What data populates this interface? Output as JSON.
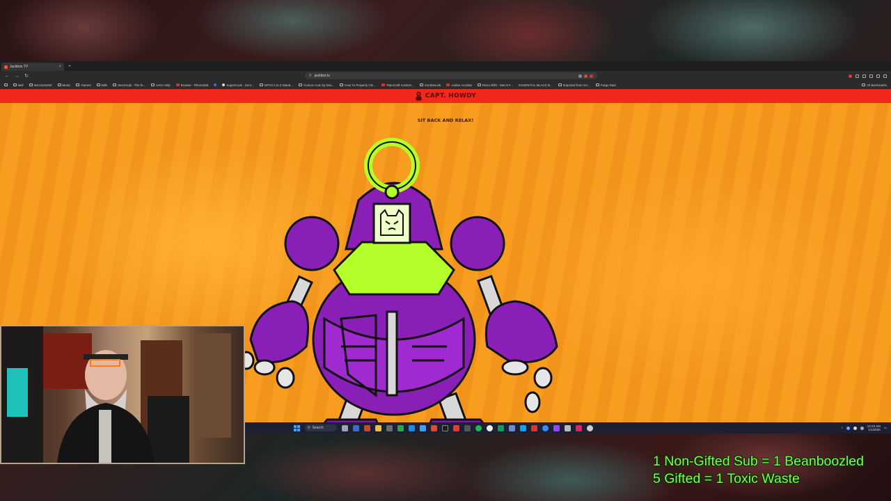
{
  "browser": {
    "tab_title": "Jackbox.TV",
    "url": "jackbox.tv",
    "bookmarks": [
      "Bell",
      "ServiceNOW",
      "Music",
      "Games",
      "Bills",
      "Stecinrojk - The fe...",
      "Uni's Help",
      "Browse - RhomoDB",
      "",
      "SuperCook - Zero...",
      "MTV2 A to Z Marat...",
      "Custom cuts by Des...",
      "How To Properly Cle...",
      "TitanCraft Custom...",
      "ZombieLink",
      "Adobe Acrobat",
      "Retro Rifle - Men's F...",
      "ESSENTIAL BLACK B...",
      "Imported from Go...",
      "Fargo Rain"
    ],
    "all_bookmarks": "All Bookmarks"
  },
  "page": {
    "player_name": "CAPT. HOWDY",
    "prompt": "SIT BACK AND RELAX!"
  },
  "taskbar": {
    "search_label": "Search",
    "time": "12:23 AM",
    "date": "1/1/2026"
  },
  "overlay": {
    "line1": "1 Non-Gifted Sub = 1 Beanboozled",
    "line2": "5 Gifted = 1 Toxic Waste"
  },
  "colors": {
    "header_red": "#f2281a",
    "page_orange": "#f79a1e",
    "robot_purple": "#8a1fb8",
    "robot_lime": "#b4ff2a",
    "overlay_green": "#7cff4a"
  }
}
